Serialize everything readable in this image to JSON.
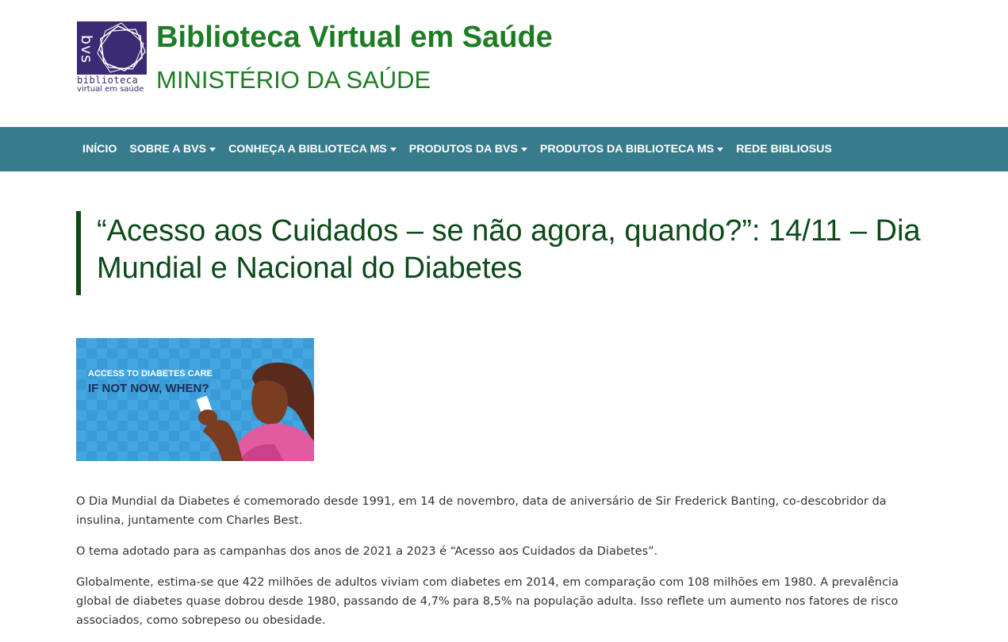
{
  "logo": {
    "mark": "bvs",
    "line1": "biblioteca",
    "line2": "virtual em saúde"
  },
  "site": {
    "title": "Biblioteca Virtual em Saúde",
    "subtitle": "MINISTÉRIO DA SAÚDE"
  },
  "nav": {
    "items": [
      {
        "label": "INÍCIO",
        "dropdown": false
      },
      {
        "label": "SOBRE A BVS",
        "dropdown": true
      },
      {
        "label": "CONHEÇA A BIBLIOTECA MS",
        "dropdown": true
      },
      {
        "label": "PRODUTOS DA BVS",
        "dropdown": true
      },
      {
        "label": "PRODUTOS DA BIBLIOTECA MS",
        "dropdown": true
      },
      {
        "label": "REDE BIBLIOSUS",
        "dropdown": false
      }
    ]
  },
  "article": {
    "title": "“Acesso aos Cuidados – se não agora, quando?”: 14/11 – Dia Mundial e Nacional do Diabetes",
    "banner": {
      "line1": "ACCESS TO DIABETES CARE",
      "line2": "IF NOT NOW, WHEN?"
    },
    "paragraphs": [
      "O Dia Mundial da Diabetes é comemorado desde 1991, em 14 de novembro, data de aniversário de Sir Frederick Banting, co-descobridor da insulina, juntamente com Charles Best.",
      "O tema adotado para as campanhas dos anos de 2021 a 2023 é “Acesso aos Cuidados da Diabetes”.",
      "Globalmente, estima-se que 422 milhões de adultos viviam com diabetes em 2014, em comparação com 108 milhões em 1980. A prevalência global de diabetes quase dobrou desde 1980, passando de 4,7% para 8,5% na população adulta. Isso reflete um aumento nos fatores de risco associados, como sobrepeso ou obesidade."
    ]
  },
  "colors": {
    "brand_green": "#1e7d24",
    "nav_bg": "#387b8c",
    "headline": "#0c4a1a",
    "logo_purple": "#3b2a74"
  }
}
